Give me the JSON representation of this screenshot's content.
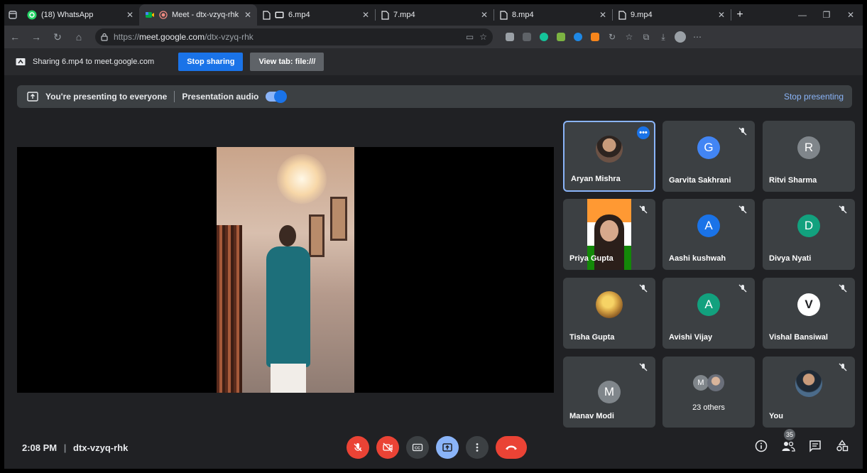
{
  "browser": {
    "tabs": [
      {
        "label": "(18) WhatsApp",
        "icon": "whatsapp-icon",
        "active": false
      },
      {
        "label": "Meet - dtx-vzyq-rhk",
        "icon": "google-meet-icon",
        "active": true
      },
      {
        "label": "6.mp4",
        "icon": "file-icon",
        "active": false
      },
      {
        "label": "7.mp4",
        "icon": "file-icon",
        "active": false
      },
      {
        "label": "8.mp4",
        "icon": "file-icon",
        "active": false
      },
      {
        "label": "9.mp4",
        "icon": "file-icon",
        "active": false
      }
    ],
    "url_prefix": "https://",
    "url_host": "meet.google.com",
    "url_path": "/dtx-vzyq-rhk"
  },
  "sharing": {
    "text": "Sharing 6.mp4 to meet.google.com",
    "stop_label": "Stop sharing",
    "view_label": "View tab: file:///"
  },
  "presenting": {
    "message": "You're presenting to everyone",
    "audio_label": "Presentation audio",
    "stop_label": "Stop presenting"
  },
  "participants": [
    {
      "name": "Aryan Mishra",
      "kind": "photo",
      "color": "#8b5a3c",
      "muted": false,
      "active": true
    },
    {
      "name": "Garvita Sakhrani",
      "kind": "letter",
      "letter": "G",
      "color": "#4285f4",
      "muted": true
    },
    {
      "name": "Ritvi Sharma",
      "kind": "letter",
      "letter": "R",
      "color": "#80868b",
      "muted": false
    },
    {
      "name": "Priya Gupta",
      "kind": "photo",
      "color": "#c7a58a",
      "muted": true
    },
    {
      "name": "Aashi kushwah",
      "kind": "letter",
      "letter": "A",
      "color": "#1a73e8",
      "muted": true
    },
    {
      "name": "Divya Nyati",
      "kind": "letter",
      "letter": "D",
      "color": "#12a17e",
      "muted": true
    },
    {
      "name": "Tisha Gupta",
      "kind": "photo",
      "color": "#d4a143",
      "muted": true
    },
    {
      "name": "Avishi Vijay",
      "kind": "letter",
      "letter": "A",
      "color": "#12a17e",
      "muted": true
    },
    {
      "name": "Vishal Bansiwal",
      "kind": "letter",
      "letter": "V",
      "color": "#ffffff",
      "muted": true
    },
    {
      "name": "Manav Modi",
      "kind": "letter",
      "letter": "M",
      "color": "#80868b",
      "muted": true
    },
    {
      "name": "23 others",
      "kind": "others",
      "letter": "M",
      "color": "#80868b",
      "muted": false
    },
    {
      "name": "You",
      "kind": "photo",
      "color": "#4b6b8a",
      "muted": true
    }
  ],
  "meeting": {
    "time": "2:08 PM",
    "code": "dtx-vzyq-rhk",
    "participant_count": "35"
  },
  "colors": {
    "accent": "#8ab4f8",
    "danger": "#ea4335",
    "surface": "#3c4043"
  }
}
